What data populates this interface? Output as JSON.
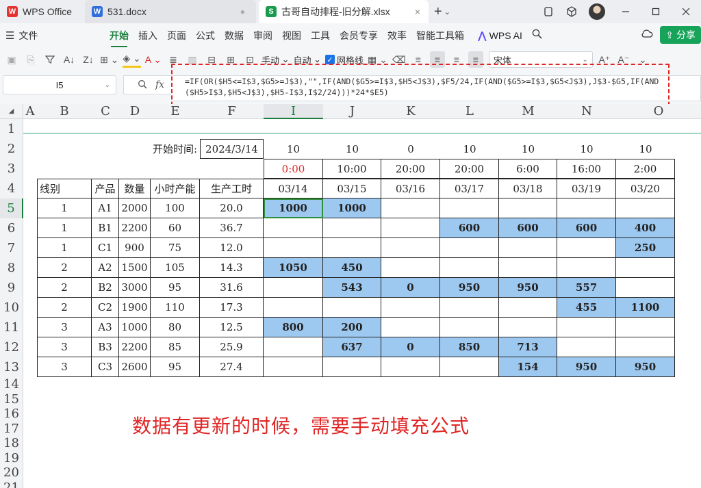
{
  "titlebar": {
    "tabs": [
      {
        "label": "WPS Office",
        "badge": "W",
        "color": "#e3342f"
      },
      {
        "label": "531.docx",
        "badge": "W",
        "color": "#2f6fdb"
      },
      {
        "label": "古哥自动排程-旧分解.xlsx",
        "badge": "S",
        "color": "#1a9c50"
      }
    ],
    "new_tab": "+",
    "close_glyph": "×",
    "dot_glyph": "●",
    "dropdown_glyph": "⌄"
  },
  "menubar": {
    "file": "文件",
    "items": [
      "开始",
      "插入",
      "页面",
      "公式",
      "数据",
      "审阅",
      "视图",
      "工具",
      "会员专享",
      "效率",
      "智能工具箱"
    ],
    "ai": "WPS AI",
    "share": "分享"
  },
  "toolbar": {
    "manual": "手动",
    "auto": "自动",
    "gridlines": "网格线",
    "font": "宋体"
  },
  "formula_bar": {
    "name_box": "I5",
    "fx": "fx",
    "formula": "=IF(OR($H5<=I$3,$G5>=J$3),\"\",IF(AND($G5>=I$3,$H5<J$3),$F5/24,IF(AND($G5>=I$3,$G5<J$3),J$3-$G5,IF(AND($H5>I$3,$H5<J$3),$H5-I$3,I$2/24)))*24*$E5)"
  },
  "columns": [
    "A",
    "B",
    "C",
    "D",
    "E",
    "F",
    "I",
    "J",
    "K",
    "L",
    "M",
    "N",
    "O"
  ],
  "rows": [
    "1",
    "2",
    "3",
    "4",
    "5",
    "6",
    "7",
    "8",
    "9",
    "10",
    "11",
    "12",
    "13",
    "14",
    "15",
    "16",
    "17",
    "18",
    "19",
    "20",
    "21"
  ],
  "sheet": {
    "start_label": "开始时间:",
    "start_date": "2024/3/14",
    "hours_row": [
      "10",
      "10",
      "0",
      "10",
      "10",
      "10",
      "10"
    ],
    "time_row": [
      "0:00",
      "10:00",
      "20:00",
      "20:00",
      "6:00",
      "16:00",
      "2:00"
    ],
    "date_row": [
      "03/14",
      "03/15",
      "03/16",
      "03/17",
      "03/18",
      "03/19",
      "03/20"
    ],
    "headers": [
      "线别",
      "产品",
      "数量",
      "小时产能",
      "生产工时"
    ],
    "data": [
      {
        "line": "1",
        "product": "A1",
        "qty": "2000",
        "cap": "100",
        "hours": "20.0",
        "sched": [
          "1000",
          "1000",
          "",
          "",
          "",
          "",
          ""
        ]
      },
      {
        "line": "1",
        "product": "B1",
        "qty": "2200",
        "cap": "60",
        "hours": "36.7",
        "sched": [
          "",
          "",
          "",
          "600",
          "600",
          "600",
          "400"
        ]
      },
      {
        "line": "1",
        "product": "C1",
        "qty": "900",
        "cap": "75",
        "hours": "12.0",
        "sched": [
          "",
          "",
          "",
          "",
          "",
          "",
          "250"
        ]
      },
      {
        "line": "2",
        "product": "A2",
        "qty": "1500",
        "cap": "105",
        "hours": "14.3",
        "sched": [
          "1050",
          "450",
          "",
          "",
          "",
          "",
          ""
        ]
      },
      {
        "line": "2",
        "product": "B2",
        "qty": "3000",
        "cap": "95",
        "hours": "31.6",
        "sched": [
          "",
          "543",
          "0",
          "950",
          "950",
          "557",
          ""
        ]
      },
      {
        "line": "2",
        "product": "C2",
        "qty": "1900",
        "cap": "110",
        "hours": "17.3",
        "sched": [
          "",
          "",
          "",
          "",
          "",
          "455",
          "1100"
        ]
      },
      {
        "line": "3",
        "product": "A3",
        "qty": "1000",
        "cap": "80",
        "hours": "12.5",
        "sched": [
          "800",
          "200",
          "",
          "",
          "",
          "",
          ""
        ]
      },
      {
        "line": "3",
        "product": "B3",
        "qty": "2200",
        "cap": "85",
        "hours": "25.9",
        "sched": [
          "",
          "637",
          "0",
          "850",
          "713",
          "",
          ""
        ]
      },
      {
        "line": "3",
        "product": "C3",
        "qty": "2600",
        "cap": "95",
        "hours": "27.4",
        "sched": [
          "",
          "",
          "",
          "",
          "154",
          "950",
          "950"
        ]
      }
    ]
  },
  "annotation": "数据有更新的时候，需要手动填充公式",
  "colors": {
    "accent": "#1a7f3c",
    "cell_blue": "#9dc8f0",
    "annotation_red": "#e02525"
  }
}
